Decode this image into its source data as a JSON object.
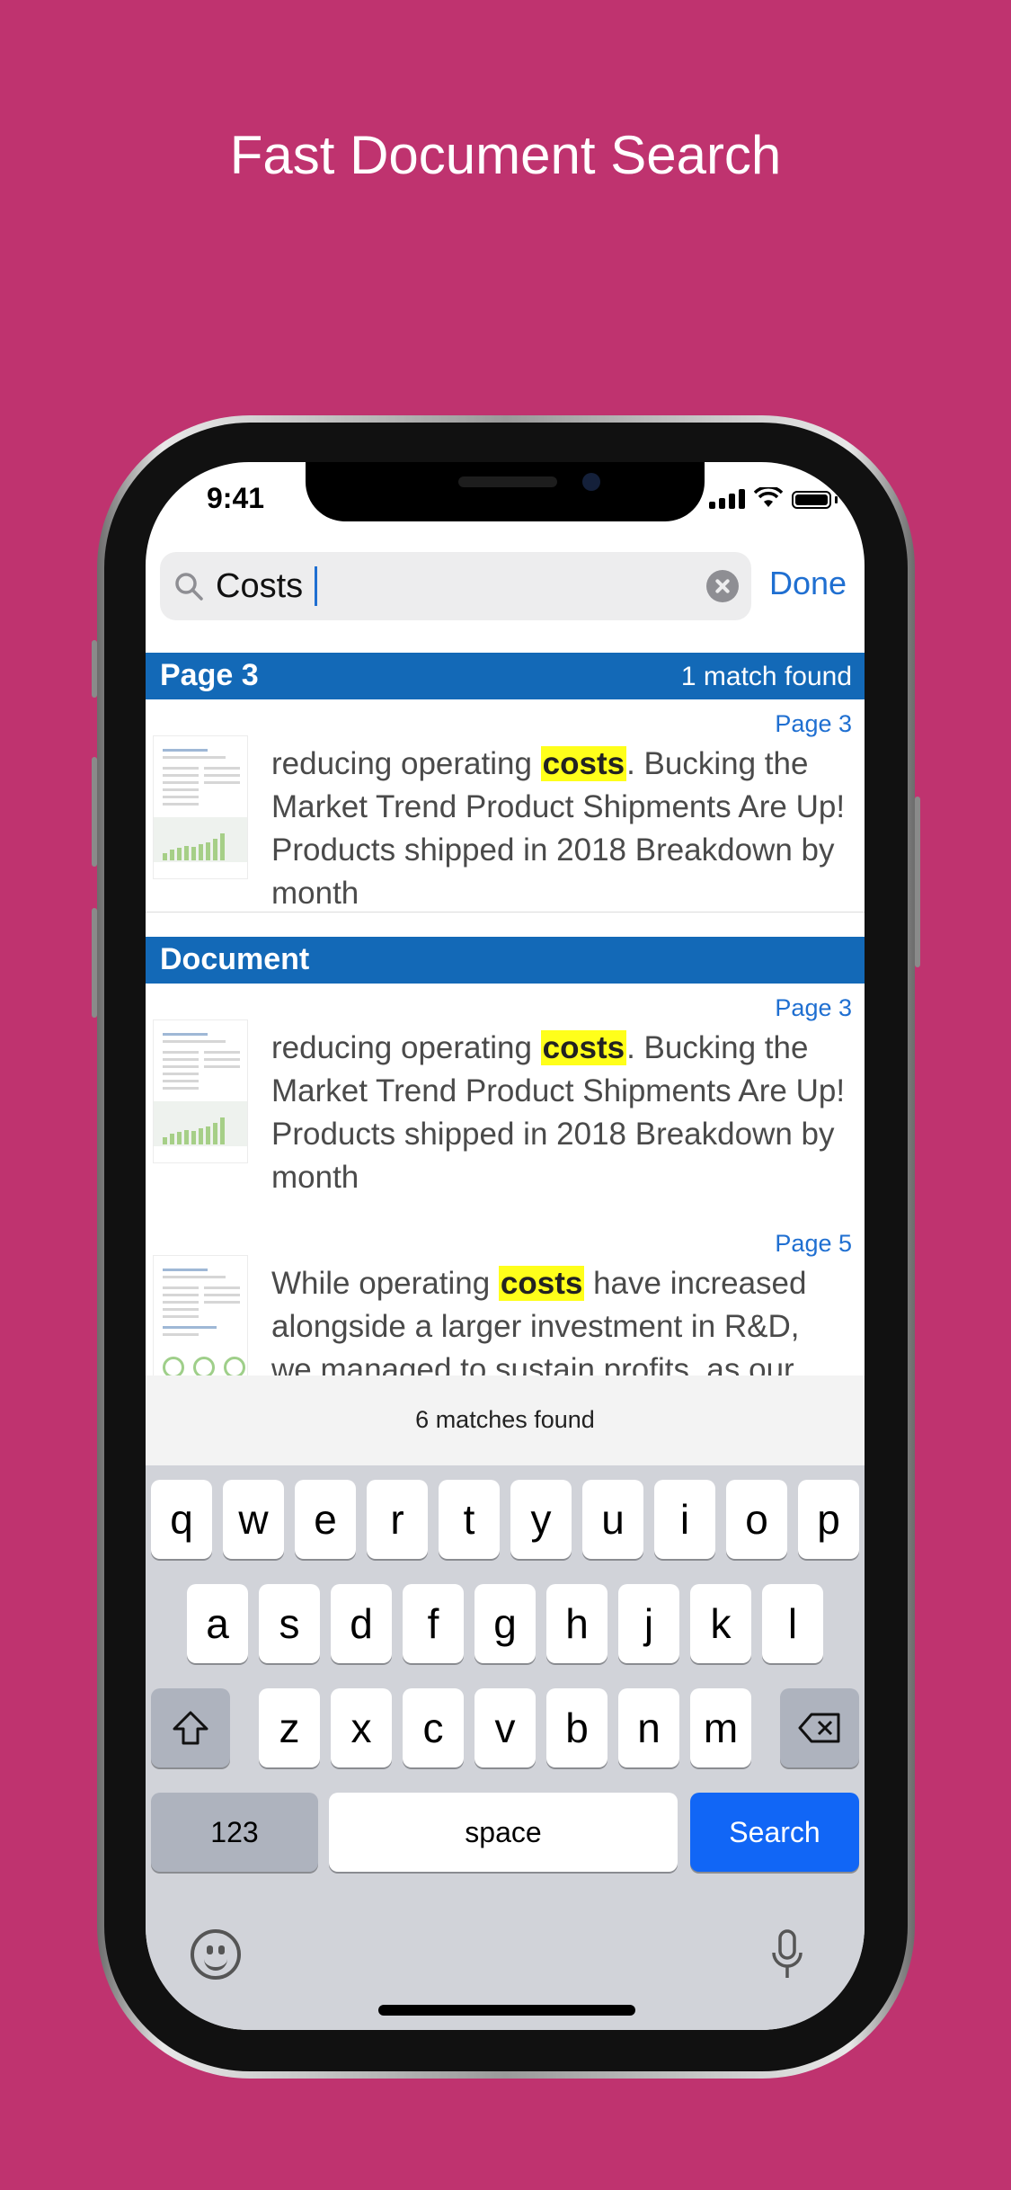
{
  "headline": "Fast Document Search",
  "status": {
    "time": "9:41"
  },
  "search": {
    "value": "Costs",
    "done_label": "Done"
  },
  "sections": [
    {
      "title": "Page 3",
      "count": "1 match found"
    },
    {
      "title": "Document",
      "count": ""
    }
  ],
  "results": [
    {
      "page": "Page 3",
      "before": "reducing operating ",
      "match": "costs",
      "after": ". Bucking the Market Trend Product Shipments Are Up! Products shipped in 2018 Breakdown by month"
    },
    {
      "page": "Page 3",
      "before": "reducing operating ",
      "match": "costs",
      "after": ". Bucking the Market Trend Product Shipments Are Up! Products shipped in 2018 Breakdown by month"
    },
    {
      "page": "Page 5",
      "before": "While operating ",
      "match": "costs",
      "after": " have increased alongside a larger investment in R&D, we managed to sustain profits, as our"
    }
  ],
  "footer": {
    "matches": "6 matches found"
  },
  "keyboard": {
    "row1": [
      "q",
      "w",
      "e",
      "r",
      "t",
      "y",
      "u",
      "i",
      "o",
      "p"
    ],
    "row2": [
      "a",
      "s",
      "d",
      "f",
      "g",
      "h",
      "j",
      "k",
      "l"
    ],
    "row3": [
      "z",
      "x",
      "c",
      "v",
      "b",
      "n",
      "m"
    ],
    "numbers_label": "123",
    "space_label": "space",
    "search_label": "Search",
    "icons": {
      "shift": "shift-icon",
      "delete": "delete-icon",
      "emoji": "emoji-icon",
      "mic": "microphone-icon"
    }
  },
  "colors": {
    "background": "#BF336F",
    "section_header": "#1369B7",
    "link": "#1F6FD1",
    "highlight": "#FFFF1A",
    "search_key": "#1166F6"
  }
}
